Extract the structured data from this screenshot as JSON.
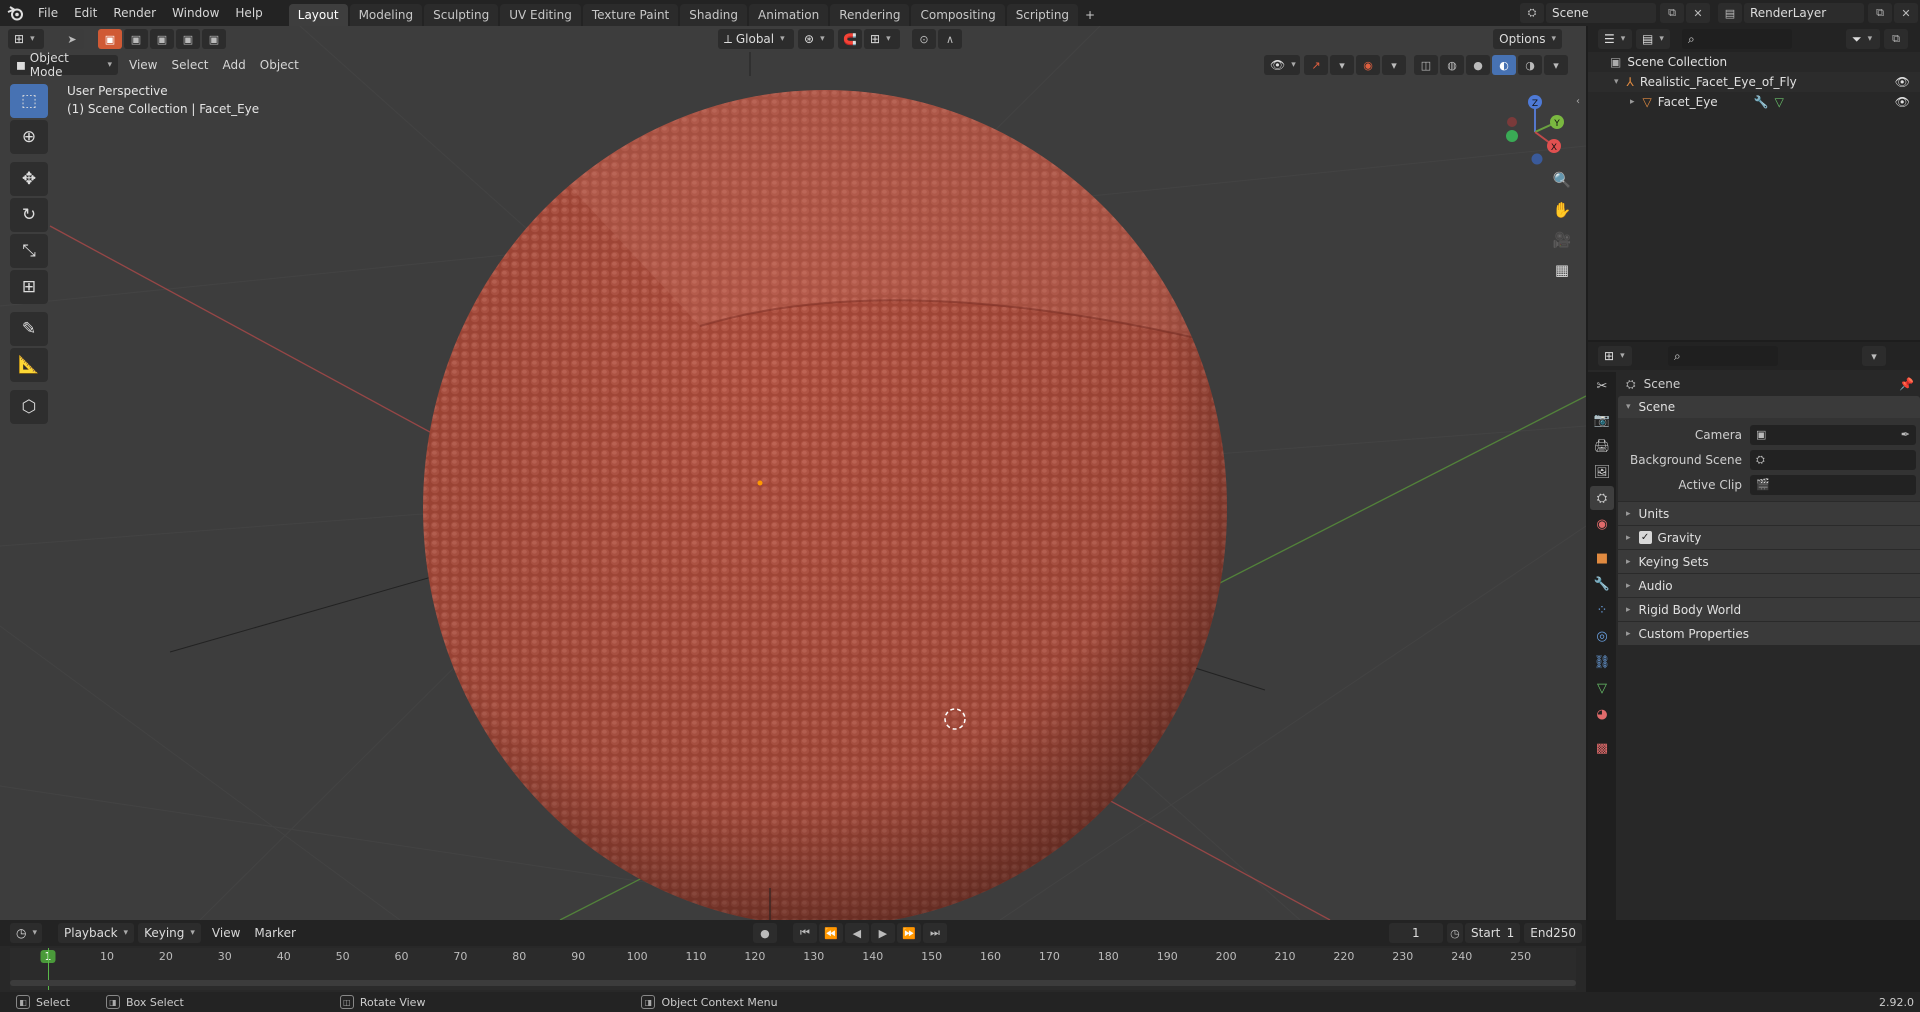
{
  "topbar": {
    "menus": [
      "File",
      "Edit",
      "Render",
      "Window",
      "Help"
    ],
    "workspaces": [
      "Layout",
      "Modeling",
      "Sculpting",
      "UV Editing",
      "Texture Paint",
      "Shading",
      "Animation",
      "Rendering",
      "Compositing",
      "Scripting"
    ],
    "active_workspace": "Layout",
    "scene_name": "Scene",
    "view_layer": "RenderLayer"
  },
  "viewport": {
    "mode": "Object Mode",
    "menus": [
      "View",
      "Select",
      "Add",
      "Object"
    ],
    "transform_orientation": "Global",
    "options_label": "Options",
    "view_name": "User Perspective",
    "context": "(1) Scene Collection | Facet_Eye",
    "axis_labels": {
      "x": "X",
      "y": "Y",
      "z": "Z"
    },
    "colors": {
      "background": "#3d3d3d",
      "sphere": "#a84a3a",
      "x_axis": "#b44a4a",
      "y_axis": "#5a9a3a",
      "selected_tool": "#4772b3"
    },
    "tools": [
      "select-box-icon",
      "cursor-icon",
      "move-icon",
      "rotate-icon",
      "scale-icon",
      "transform-icon",
      "annotate-icon",
      "measure-icon",
      "add-cube-icon"
    ]
  },
  "outliner": {
    "root": "Scene Collection",
    "collection": "Realistic_Facet_Eye_of_Fly",
    "object": "Facet_Eye"
  },
  "properties": {
    "context": "Scene",
    "panel_title": "Scene",
    "camera_label": "Camera",
    "background_scene_label": "Background Scene",
    "active_clip_label": "Active Clip",
    "subpanels": [
      "Units",
      "Gravity",
      "Keying Sets",
      "Audio",
      "Rigid Body World",
      "Custom Properties"
    ],
    "gravity_checked": true
  },
  "timeline": {
    "menus": [
      "Playback",
      "Keying",
      "View",
      "Marker"
    ],
    "current_frame": "1",
    "start_label": "Start",
    "start": "1",
    "end_label": "End",
    "end": "250",
    "ticks": [
      "1",
      "10",
      "20",
      "30",
      "40",
      "50",
      "60",
      "70",
      "80",
      "90",
      "100",
      "110",
      "120",
      "130",
      "140",
      "150",
      "160",
      "170",
      "180",
      "190",
      "200",
      "210",
      "220",
      "230",
      "240",
      "250"
    ]
  },
  "status": {
    "select": "Select",
    "box_select": "Box Select",
    "rotate_view": "Rotate View",
    "context_menu": "Object Context Menu",
    "version": "2.92.0"
  }
}
